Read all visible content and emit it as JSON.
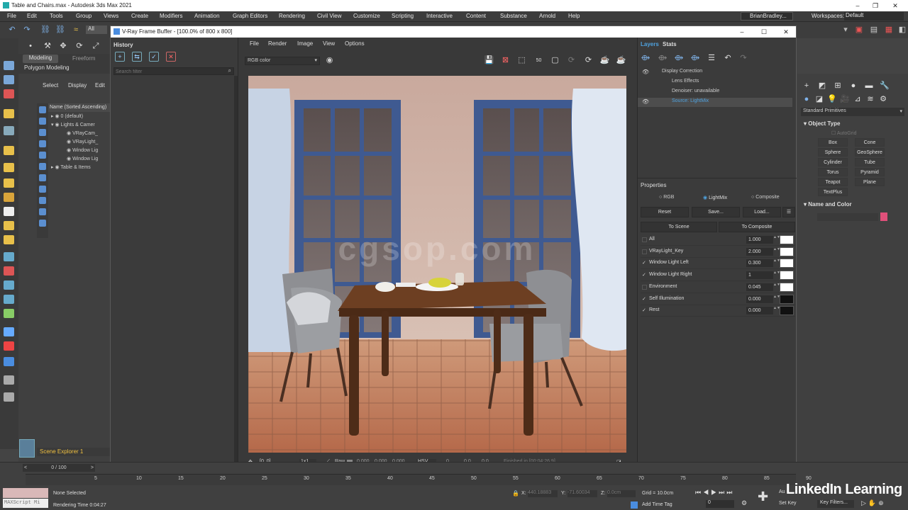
{
  "app": {
    "title": "Table and Chairs.max - Autodesk 3ds Max 2021",
    "user": "BrianBradley...",
    "workspaces_label": "Workspaces:",
    "workspace": "Default"
  },
  "menu": [
    "File",
    "Edit",
    "Tools",
    "Group",
    "Views",
    "Create",
    "Modifiers",
    "Animation",
    "Graph Editors",
    "Rendering",
    "Civil View",
    "Customize",
    "Scripting",
    "Interactive",
    "Content",
    "Substance",
    "Arnold",
    "Help"
  ],
  "toolbar": {
    "all_label": "All"
  },
  "ribbon": {
    "tabs": [
      "Modeling",
      "Freeform"
    ],
    "sub": "Polygon Modeling"
  },
  "explorer": {
    "tabs": [
      "Select",
      "Display",
      "Edit"
    ],
    "header": "Name (Sorted Ascending)",
    "items": [
      "0 (default)",
      "Lights & Camer",
      "VRayCam_",
      "VRayLight_",
      "Window Lig",
      "Window Lig",
      "Table & Items"
    ],
    "footer": "Scene Explorer 1"
  },
  "vfb": {
    "title": "V-Ray Frame Buffer - [100.0% of 800 x 800]",
    "history_label": "History",
    "search_placeholder": "Search filter",
    "menu": [
      "File",
      "Render",
      "Image",
      "View",
      "Options"
    ],
    "channel": "RGB color",
    "status": {
      "coords": "[0, 0]",
      "zoom": "1x1",
      "raw": "Raw",
      "v1": "0.000",
      "v2": "0.000",
      "v3": "0.000",
      "mode": "HSV",
      "v4": "0",
      "v5": "0.0",
      "v6": "0.0",
      "finished": "Finished in [00:04:26.9]"
    }
  },
  "render": {
    "watermark": "cgsop.com"
  },
  "layers": {
    "tabs": [
      "Layers",
      "Stats"
    ],
    "items": [
      "Display Correction",
      "Lens Effects",
      "Denoiser: unavailable",
      "Source: LightMix"
    ]
  },
  "properties": {
    "title": "Properties",
    "modes": [
      "RGB",
      "LightMix",
      "Composite"
    ],
    "buttons": [
      "Reset",
      "Save...",
      "Load..."
    ],
    "to_scene": "To Scene",
    "to_composite": "To Composite",
    "rows": [
      {
        "name": "All",
        "value": "1.000",
        "checked": false,
        "color": "#ffffff"
      },
      {
        "name": "VRayLight_Key",
        "value": "2.000",
        "checked": false,
        "color": "#ffffff"
      },
      {
        "name": "Window Light Left",
        "value": "0.300",
        "checked": true,
        "color": "#ffffff"
      },
      {
        "name": "Window Light Right",
        "value": "1",
        "checked": true,
        "color": "#ffffff"
      },
      {
        "name": "Environment",
        "value": "0.045",
        "checked": false,
        "color": "#ffffff"
      },
      {
        "name": "Self Illumination",
        "value": "0.000",
        "checked": true,
        "color": "#111111"
      },
      {
        "name": "Rest",
        "value": "0.000",
        "checked": true,
        "color": "#111111"
      }
    ]
  },
  "command": {
    "dropdown": "Standard Primitives",
    "object_type": "Object Type",
    "autogrid": "AutoGrid",
    "prims": [
      "Box",
      "Cone",
      "Sphere",
      "GeoSphere",
      "Cylinder",
      "Tube",
      "Torus",
      "Pyramid",
      "Teapot",
      "Plane",
      "TextPlus"
    ],
    "name_color": "Name and Color",
    "swatch": "#e0507a"
  },
  "bottom": {
    "frame": "0 / 100",
    "ticks": [
      "5",
      "10",
      "15",
      "20",
      "25",
      "30",
      "35",
      "40",
      "45",
      "50",
      "55",
      "60",
      "65",
      "70",
      "75",
      "80",
      "85",
      "90"
    ],
    "none_selected": "None Selected",
    "render_time": "Rendering Time  0:04:27",
    "maxscript": "MAXScript Mi",
    "x_label": "X:",
    "x_val": "440.18883",
    "y_label": "Y:",
    "y_val": "-71.60034",
    "z_label": "Z:",
    "z_val": "0.0cm",
    "grid": "Grid = 10.0cm",
    "add_time_tag": "Add Time Tag",
    "set_key": "Set Key",
    "key_filters": "Key Filters...",
    "auto": "Au",
    "frame_field": "0"
  },
  "brand": "LinkedIn Learning"
}
